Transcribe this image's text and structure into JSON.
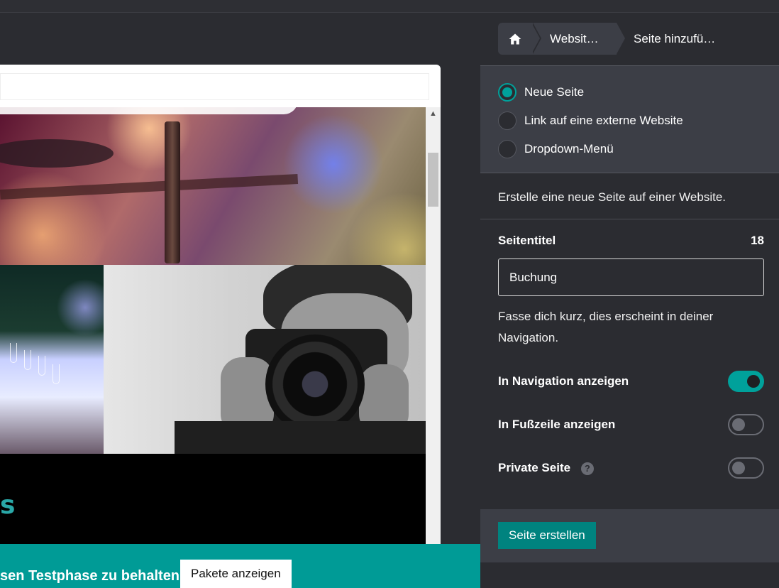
{
  "preview": {
    "banner_text": "sen Testphase zu behalten",
    "packages_button": "Pakete anzeigen",
    "teal_glyph": "s"
  },
  "breadcrumb": {
    "home_icon": "home-icon",
    "items": [
      "Websit…",
      "Seite hinzufü…"
    ]
  },
  "page_type": {
    "options": [
      {
        "label": "Neue Seite",
        "selected": true
      },
      {
        "label": "Link auf eine externe Website",
        "selected": false
      },
      {
        "label": "Dropdown-Menü",
        "selected": false
      }
    ]
  },
  "description": "Erstelle eine neue Seite auf einer Website.",
  "title_field": {
    "label": "Seitentitel",
    "counter": "18",
    "value": "Buchung",
    "hint": "Fasse dich kurz, dies erscheint in deiner Navigation."
  },
  "toggles": [
    {
      "label": "In Navigation anzeigen",
      "on": true
    },
    {
      "label": "In Fußzeile anzeigen",
      "on": false
    },
    {
      "label": "Private Seite",
      "on": false,
      "help_icon": "question-icon",
      "help_glyph": "?"
    }
  ],
  "footer": {
    "create_button": "Seite erstellen"
  },
  "colors": {
    "accent": "#00a19b",
    "panel_bg": "#2b2c31",
    "section_bg": "#3c3e46",
    "banner": "#009b96"
  }
}
